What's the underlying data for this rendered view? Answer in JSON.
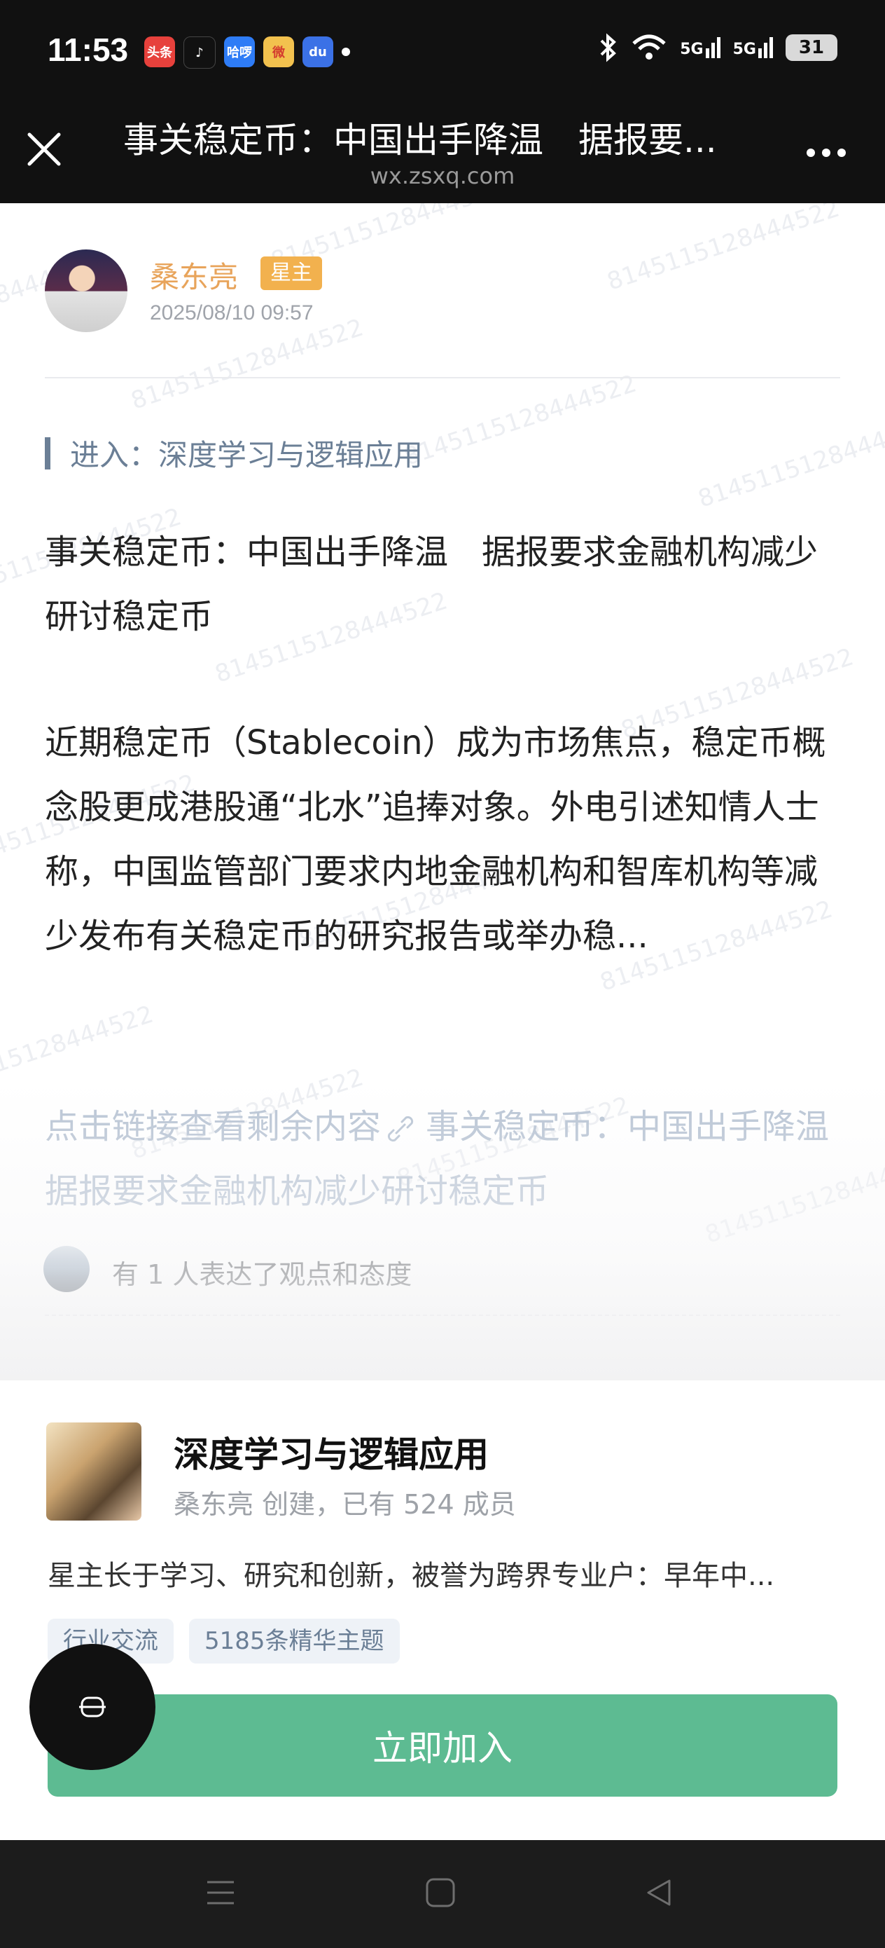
{
  "status_bar": {
    "time": "11:53",
    "app_icons": [
      {
        "name": "toutiao",
        "label": "头条",
        "color": "#e7413c"
      },
      {
        "name": "douyin",
        "label": "♪",
        "color": "#111111"
      },
      {
        "name": "haluo",
        "label": "哈啰",
        "color": "#2e7cf6"
      },
      {
        "name": "weibo",
        "label": "微",
        "color": "#f2c14e"
      },
      {
        "name": "baidu",
        "label": "du",
        "color": "#3b71e6"
      }
    ],
    "signal_1": "5G",
    "signal_2": "5G",
    "battery": "31"
  },
  "title_bar": {
    "title": "事关稳定币：中国出手降温　据报要...",
    "url": "wx.zsxq.com"
  },
  "post": {
    "author": "桑东亮",
    "badge": "星主",
    "date": "2025/08/10 09:57",
    "group_entry": "进入：深度学习与逻辑应用",
    "title": "事关稳定币：中国出手降温　据报要求金融机构减少研讨稳定币",
    "body": "近期稳定币（Stablecoin）成为市场焦点，稳定币概念股更成港股通“北水”追捧对象。外电引述知情人士称，中国监管部门要求内地金融机构和智库机构等减少发布有关稳定币的研究报告或举办稳...",
    "link_prompt": "点击链接查看剩余内容",
    "link_title": "事关稳定币：中国出手降温　据报要求金融机构减少研讨稳定币",
    "reaction_text": "有 1 人表达了观点和态度"
  },
  "watermark": "8145115128444522",
  "group_card": {
    "name": "深度学习与逻辑应用",
    "meta": "桑东亮 创建，已有 524 成员",
    "description": "星主长于学习、研究和创新，被誉为跨界专业户：早年中...",
    "tags": [
      "行业交流",
      "5185条精华主题"
    ],
    "join_label": "立即加入"
  },
  "colors": {
    "accent_green": "#5dbb92",
    "author_orange": "#e8a45b",
    "link_blue": "#b7c3d3"
  }
}
